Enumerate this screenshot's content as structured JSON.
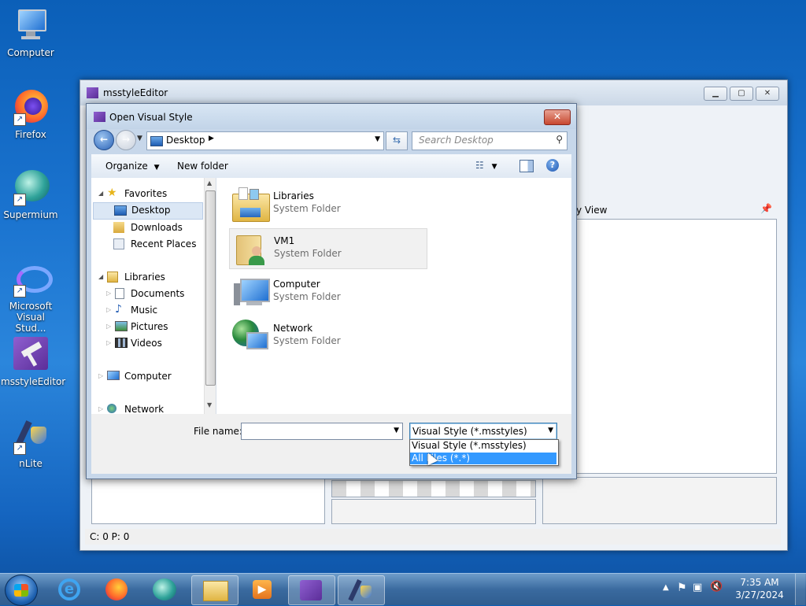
{
  "desktop": {
    "icons": [
      {
        "label": "Computer"
      },
      {
        "label": "Firefox"
      },
      {
        "label": "Supermium"
      },
      {
        "label": "Microsoft Visual Stud..."
      },
      {
        "label": "msstyleEditor"
      },
      {
        "label": "nLite"
      }
    ]
  },
  "app_window": {
    "title": "msstyleEditor",
    "property_view_label": "y View",
    "status_text": "C: 0 P: 0"
  },
  "dialog": {
    "title": "Open Visual Style",
    "close_label": "✕",
    "address": "Desktop",
    "search_placeholder": "Search Desktop",
    "toolbar": {
      "organize": "Organize",
      "new_folder": "New folder"
    },
    "nav": {
      "favorites": "Favorites",
      "desktop": "Desktop",
      "downloads": "Downloads",
      "recent_places": "Recent Places",
      "libraries": "Libraries",
      "documents": "Documents",
      "music": "Music",
      "pictures": "Pictures",
      "videos": "Videos",
      "computer": "Computer",
      "network": "Network"
    },
    "items": [
      {
        "name": "Libraries",
        "type": "System Folder"
      },
      {
        "name": "VM1",
        "type": "System Folder"
      },
      {
        "name": "Computer",
        "type": "System Folder"
      },
      {
        "name": "Network",
        "type": "System Folder"
      }
    ],
    "file_name_label": "File name:",
    "file_name_value": "",
    "filter_selected": "Visual Style (*.msstyles)",
    "filter_options": [
      "Visual Style (*.msstyles)",
      "All Files (*.*)"
    ]
  },
  "taskbar": {
    "time": "7:35 AM",
    "date": "3/27/2024"
  },
  "colors": {
    "selection": "#3399ff",
    "accent": "#0b5fb8"
  }
}
